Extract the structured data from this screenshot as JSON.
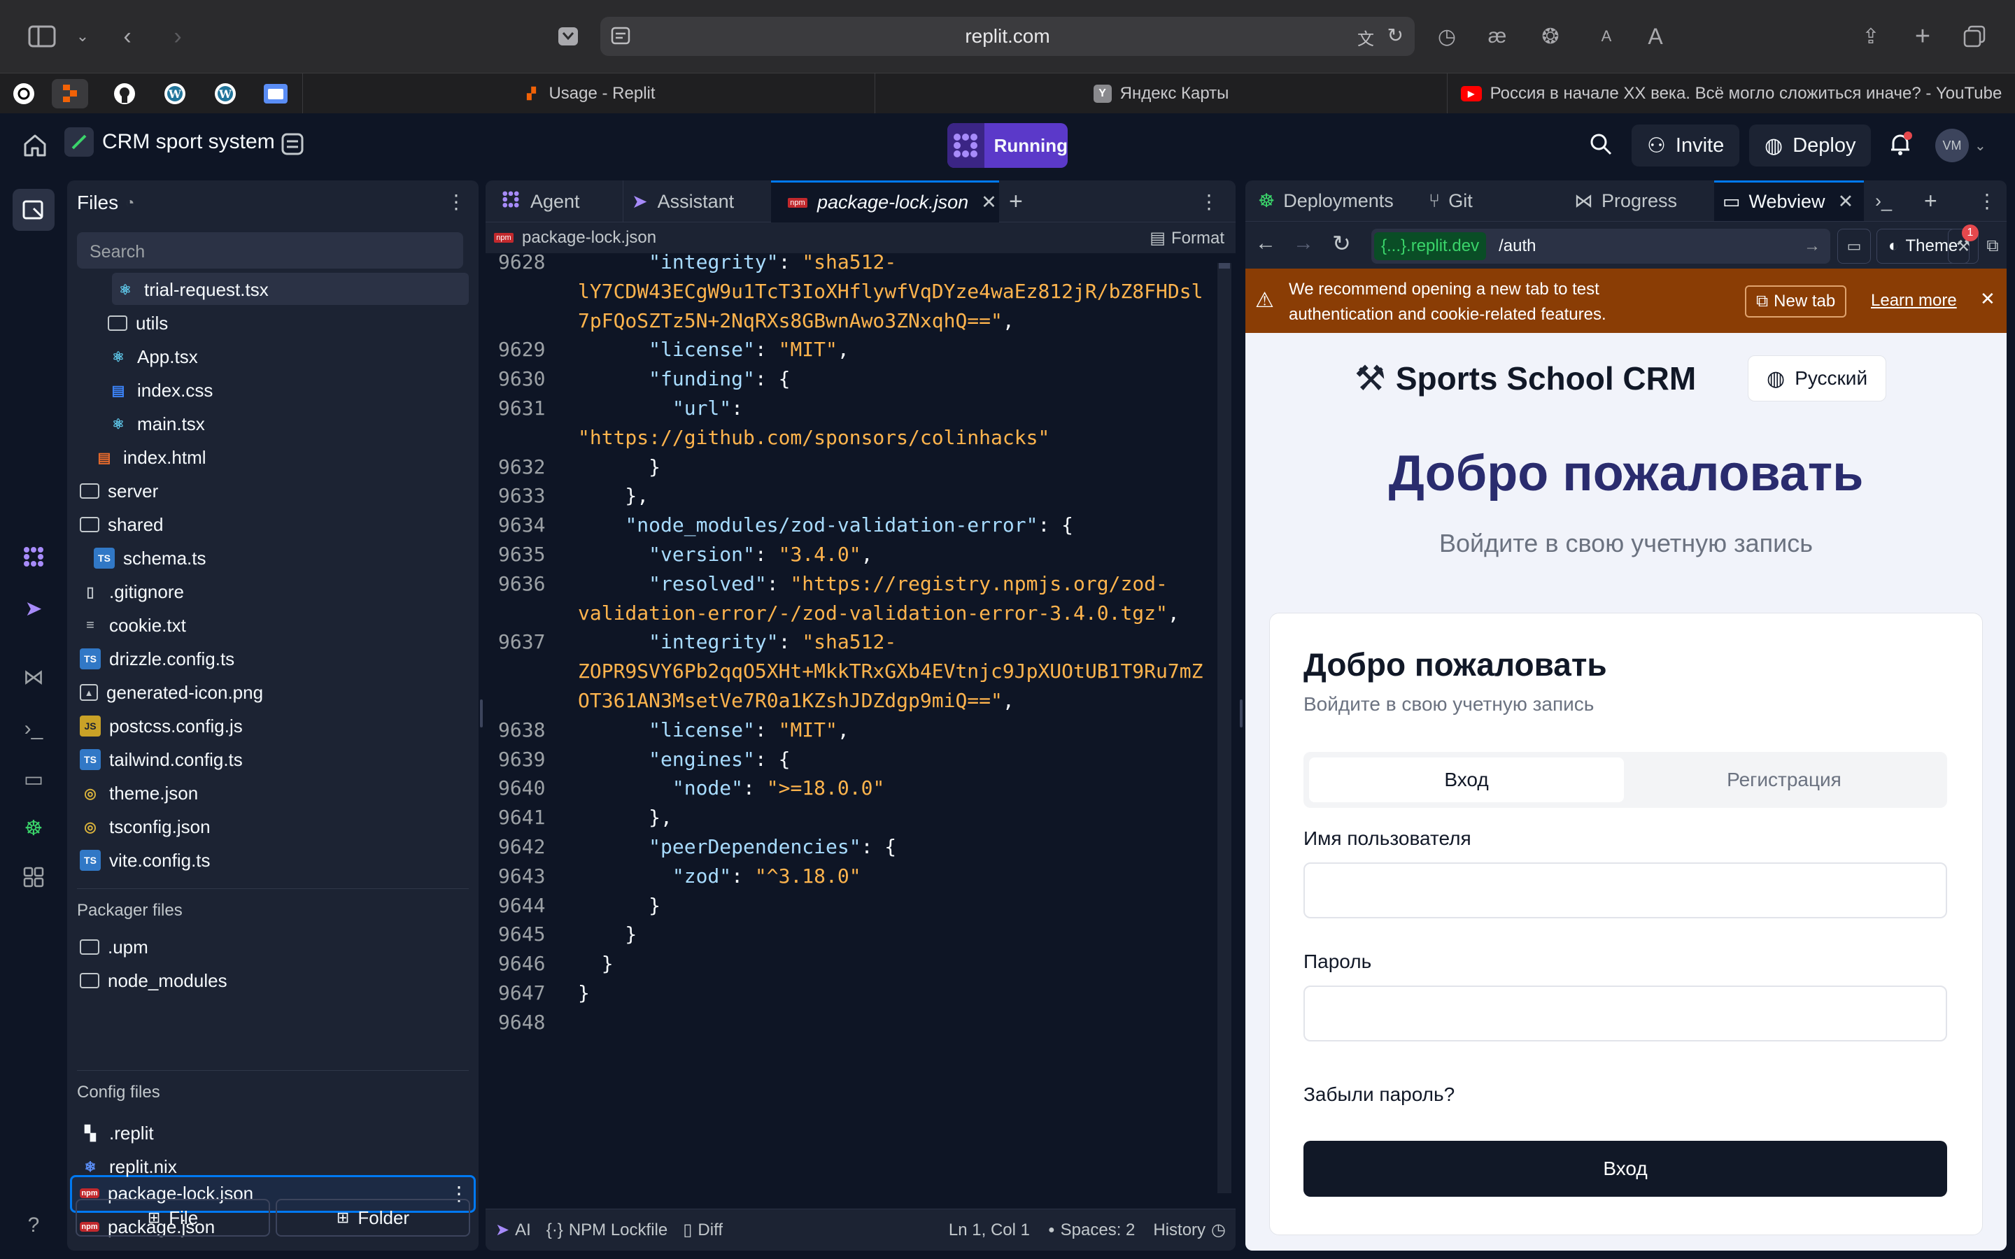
{
  "browser": {
    "url": "replit.com",
    "tabs": [
      {
        "title": "Usage - Replit",
        "color": "#f26207"
      },
      {
        "title": "Яндекс Карты",
        "color": "#8a8a8e"
      },
      {
        "title": "Россия в начале XX века. Всё могло сложиться иначе? - YouTube",
        "color": "#ff0000"
      }
    ],
    "toolbar_letters": {
      "small": "A",
      "large": "A"
    }
  },
  "header": {
    "project_name": "CRM sport system",
    "run_label": "Running",
    "invite_label": "Invite",
    "deploy_label": "Deploy",
    "avatar_initials": "VM"
  },
  "files": {
    "title": "Files",
    "search_placeholder": "Search",
    "items": [
      {
        "name": "trial-request.tsx",
        "type": "react"
      },
      {
        "name": "utils",
        "type": "folder"
      },
      {
        "name": "App.tsx",
        "type": "react"
      },
      {
        "name": "index.css",
        "type": "css"
      },
      {
        "name": "main.tsx",
        "type": "react"
      },
      {
        "name": "index.html",
        "type": "html"
      },
      {
        "name": "server",
        "type": "folder"
      },
      {
        "name": "shared",
        "type": "folder"
      },
      {
        "name": "schema.ts",
        "type": "ts"
      },
      {
        "name": ".gitignore",
        "type": "doc"
      },
      {
        "name": "cookie.txt",
        "type": "txt"
      },
      {
        "name": "drizzle.config.ts",
        "type": "ts"
      },
      {
        "name": "generated-icon.png",
        "type": "img"
      },
      {
        "name": "postcss.config.js",
        "type": "js"
      },
      {
        "name": "tailwind.config.ts",
        "type": "ts"
      },
      {
        "name": "theme.json",
        "type": "json"
      },
      {
        "name": "tsconfig.json",
        "type": "json"
      },
      {
        "name": "vite.config.ts",
        "type": "ts"
      }
    ],
    "packager_label": "Packager files",
    "packager_items": [
      {
        "name": ".upm",
        "type": "folder"
      },
      {
        "name": "node_modules",
        "type": "folder"
      },
      {
        "name": "package-lock.json",
        "type": "npm"
      },
      {
        "name": "package.json",
        "type": "npm"
      }
    ],
    "config_label": "Config files",
    "config_items": [
      {
        "name": ".replit",
        "type": "replit"
      },
      {
        "name": "replit.nix",
        "type": "nix"
      }
    ],
    "new_file_label": "File",
    "new_folder_label": "Folder"
  },
  "editor": {
    "tabs": [
      {
        "label": "Agent"
      },
      {
        "label": "Assistant"
      },
      {
        "label": "package-lock.json"
      }
    ],
    "breadcrumb": "package-lock.json",
    "format_label": "Format",
    "lines": [
      {
        "n": "9628",
        "parts": [
          {
            "t": "      ",
            "c": "p"
          },
          {
            "t": "\"integrity\"",
            "c": "k"
          },
          {
            "t": ": ",
            "c": "p"
          },
          {
            "t": "\"sha512-",
            "c": "s"
          }
        ]
      },
      {
        "n": "",
        "parts": [
          {
            "t": "lY7CDW43ECgW9u1TcT3IoXHflywfVqDYze4waEz812jR/bZ8FHDsl",
            "c": "s"
          }
        ]
      },
      {
        "n": "",
        "parts": [
          {
            "t": "7pFQoSZTz5N+2NqRXs8GBwnAwo3ZNxqhQ==\"",
            "c": "s"
          },
          {
            "t": ",",
            "c": "p"
          }
        ]
      },
      {
        "n": "9629",
        "parts": [
          {
            "t": "      ",
            "c": "p"
          },
          {
            "t": "\"license\"",
            "c": "k"
          },
          {
            "t": ": ",
            "c": "p"
          },
          {
            "t": "\"MIT\"",
            "c": "s"
          },
          {
            "t": ",",
            "c": "p"
          }
        ]
      },
      {
        "n": "9630",
        "parts": [
          {
            "t": "      ",
            "c": "p"
          },
          {
            "t": "\"funding\"",
            "c": "k"
          },
          {
            "t": ": {",
            "c": "p"
          }
        ]
      },
      {
        "n": "9631",
        "parts": [
          {
            "t": "        ",
            "c": "p"
          },
          {
            "t": "\"url\"",
            "c": "k"
          },
          {
            "t": ":",
            "c": "p"
          }
        ]
      },
      {
        "n": "",
        "parts": [
          {
            "t": "\"https://github.com/sponsors/colinhacks\"",
            "c": "s"
          }
        ]
      },
      {
        "n": "9632",
        "parts": [
          {
            "t": "      }",
            "c": "p"
          }
        ]
      },
      {
        "n": "9633",
        "parts": [
          {
            "t": "    },",
            "c": "p"
          }
        ]
      },
      {
        "n": "9634",
        "parts": [
          {
            "t": "    ",
            "c": "p"
          },
          {
            "t": "\"node_modules/zod-validation-error\"",
            "c": "k"
          },
          {
            "t": ": {",
            "c": "p"
          }
        ]
      },
      {
        "n": "9635",
        "parts": [
          {
            "t": "      ",
            "c": "p"
          },
          {
            "t": "\"version\"",
            "c": "k"
          },
          {
            "t": ": ",
            "c": "p"
          },
          {
            "t": "\"3.4.0\"",
            "c": "s"
          },
          {
            "t": ",",
            "c": "p"
          }
        ]
      },
      {
        "n": "9636",
        "parts": [
          {
            "t": "      ",
            "c": "p"
          },
          {
            "t": "\"resolved\"",
            "c": "k"
          },
          {
            "t": ": ",
            "c": "p"
          },
          {
            "t": "\"https://registry.npmjs.org/zod-",
            "c": "s"
          }
        ]
      },
      {
        "n": "",
        "parts": [
          {
            "t": "validation-error/-/zod-validation-error-3.4.0.tgz\"",
            "c": "s"
          },
          {
            "t": ",",
            "c": "p"
          }
        ]
      },
      {
        "n": "9637",
        "parts": [
          {
            "t": "      ",
            "c": "p"
          },
          {
            "t": "\"integrity\"",
            "c": "k"
          },
          {
            "t": ": ",
            "c": "p"
          },
          {
            "t": "\"sha512-",
            "c": "s"
          }
        ]
      },
      {
        "n": "",
        "parts": [
          {
            "t": "ZOPR9SVY6Pb2qqO5XHt+MkkTRxGXb4EVtnjc9JpXUOtUB1T9Ru7mZ",
            "c": "s"
          }
        ]
      },
      {
        "n": "",
        "parts": [
          {
            "t": "OT361AN3MsetVe7R0a1KZshJDZdgp9miQ==\"",
            "c": "s"
          },
          {
            "t": ",",
            "c": "p"
          }
        ]
      },
      {
        "n": "9638",
        "parts": [
          {
            "t": "      ",
            "c": "p"
          },
          {
            "t": "\"license\"",
            "c": "k"
          },
          {
            "t": ": ",
            "c": "p"
          },
          {
            "t": "\"MIT\"",
            "c": "s"
          },
          {
            "t": ",",
            "c": "p"
          }
        ]
      },
      {
        "n": "9639",
        "parts": [
          {
            "t": "      ",
            "c": "p"
          },
          {
            "t": "\"engines\"",
            "c": "k"
          },
          {
            "t": ": {",
            "c": "p"
          }
        ]
      },
      {
        "n": "9640",
        "parts": [
          {
            "t": "        ",
            "c": "p"
          },
          {
            "t": "\"node\"",
            "c": "k"
          },
          {
            "t": ": ",
            "c": "p"
          },
          {
            "t": "\">=18.0.0\"",
            "c": "s"
          }
        ]
      },
      {
        "n": "9641",
        "parts": [
          {
            "t": "      },",
            "c": "p"
          }
        ]
      },
      {
        "n": "9642",
        "parts": [
          {
            "t": "      ",
            "c": "p"
          },
          {
            "t": "\"peerDependencies\"",
            "c": "k"
          },
          {
            "t": ": {",
            "c": "p"
          }
        ]
      },
      {
        "n": "9643",
        "parts": [
          {
            "t": "        ",
            "c": "p"
          },
          {
            "t": "\"zod\"",
            "c": "k"
          },
          {
            "t": ": ",
            "c": "p"
          },
          {
            "t": "\"^3.18.0\"",
            "c": "s"
          }
        ]
      },
      {
        "n": "9644",
        "parts": [
          {
            "t": "      }",
            "c": "p"
          }
        ]
      },
      {
        "n": "9645",
        "parts": [
          {
            "t": "    }",
            "c": "p"
          }
        ]
      },
      {
        "n": "9646",
        "parts": [
          {
            "t": "  }",
            "c": "p"
          }
        ]
      },
      {
        "n": "9647",
        "parts": [
          {
            "t": "}",
            "c": "p"
          }
        ]
      },
      {
        "n": "9648",
        "parts": []
      }
    ],
    "status": {
      "ai": "AI",
      "lockfile": "NPM Lockfile",
      "diff": "Diff",
      "cursor": "Ln 1, Col 1",
      "spaces": "Spaces: 2",
      "history": "History"
    }
  },
  "right_panel": {
    "tabs": [
      {
        "label": "Deployments"
      },
      {
        "label": "Git"
      },
      {
        "label": "Progress"
      },
      {
        "label": "Webview"
      }
    ],
    "url_host": "{...}.replit.dev",
    "url_path": "/auth",
    "theme_label": "Theme",
    "notification_count": "1",
    "warning_text": "We recommend opening a new tab to test authentication and cookie-related features.",
    "new_tab_label": "New tab",
    "learn_more_label": "Learn more"
  },
  "app": {
    "brand": "Sports School CRM",
    "language": "Русский",
    "hero_title": "Добро пожаловать",
    "hero_subtitle": "Войдите в свою учетную запись",
    "card_title": "Добро пожаловать",
    "card_subtitle": "Войдите в свою учетную запись",
    "tab_login": "Вход",
    "tab_register": "Регистрация",
    "username_label": "Имя пользователя",
    "password_label": "Пароль",
    "forgot_label": "Забыли пароль?",
    "submit_label": "Вход"
  }
}
